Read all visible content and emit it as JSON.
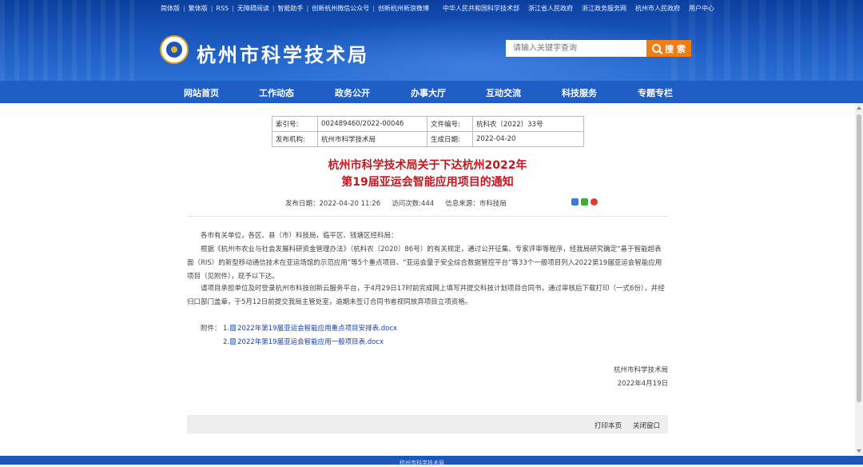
{
  "header": {
    "top_links_left": [
      "简体版",
      "繁体版",
      "RSS",
      "无障碍阅读",
      "智能助手",
      "创新杭州微信公众号",
      "创新杭州新浪微博"
    ],
    "top_links_right": [
      "中华人民共和国科学技术部",
      "浙江省人民政府",
      "浙江政务服务网",
      "杭州市人民政府",
      "用户中心"
    ],
    "site_name": "杭州市科学技术局",
    "search_placeholder": "请输入关键字查询",
    "search_button": "搜 索"
  },
  "nav": [
    "网站首页",
    "工作动态",
    "政务公开",
    "办事大厅",
    "互动交流",
    "科技服务",
    "专题专栏"
  ],
  "meta": {
    "index_label": "索引号:",
    "index_value": "002489460/2022-00046",
    "docnum_label": "文件编号:",
    "docnum_value": "杭科农〔2022〕33号",
    "org_label": "发布机构:",
    "org_value": "杭州市科学技术局",
    "date_label": "生成日期:",
    "date_value": "2022-04-20"
  },
  "article": {
    "title_line1": "杭州市科学技术局关于下达杭州2022年",
    "title_line2": "第19届亚运会智能应用项目的通知",
    "publish": "发布日期：2022-04-20 11:26",
    "views": "访问次数:444",
    "source": "信息来源：市科技局",
    "greeting": "各市有关单位，各区、县（市）科技局，临平区、钱塘区经科局：",
    "body1": "根据《杭州市农业与社会发展科研资金管理办法》（杭科农〔2020〕86号）的有关规定，通过公开征集、专家评审等程序，经我局研究确定“基于智能超表面（RIS）的新型移动通信技术在亚运场馆的示范应用”等5个重点项目、“亚运会量子安全综合数据管控平台”等33个一般项目列入2022第19届亚运会智能应用项目（见附件），现予以下达。",
    "body2": "请项目承担单位及时登录杭州市科技创新云服务平台，于4月29日17时前完成网上填写并提交科技计划项目合同书，通过审核后下载打印（一式6份），并经归口部门盖章，于5月12日前提交我局主管处室，逾期未签订合同书者视同放弃项目立项资格。",
    "attach_label": "附件：",
    "attachments": [
      {
        "num": "1.",
        "name": "2022年第19届亚运会智能应用重点项目安排表.docx"
      },
      {
        "num": "2.",
        "name": "2022年第19届亚运会智能应用一般项目表.docx"
      }
    ],
    "sign_org": "杭州市科学技术局",
    "sign_date": "2022年4月19日"
  },
  "footer": {
    "print": "打印本页",
    "close": "关闭窗口",
    "bottom_text": "杭州市科学技术局"
  },
  "colors": {
    "header_blue": "#1c5cc3",
    "nav_blue": "#1f5ec4",
    "title_red": "#c4161c",
    "search_orange": "#f07d14",
    "link_blue": "#1a3fa6"
  }
}
